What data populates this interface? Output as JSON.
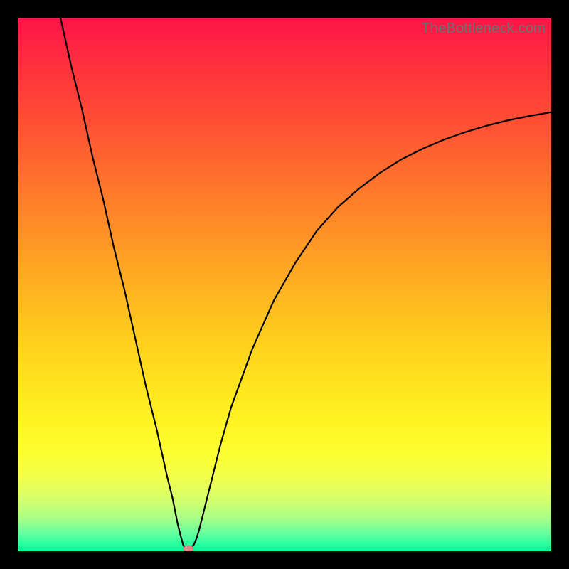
{
  "watermark": "TheBottleneck.com",
  "chart_data": {
    "type": "line",
    "title": "",
    "xlabel": "",
    "ylabel": "",
    "xlim": [
      0,
      100
    ],
    "ylim": [
      0,
      100
    ],
    "x": [
      8,
      10,
      12,
      14,
      16,
      18,
      20,
      22,
      24,
      26,
      28,
      29,
      30,
      30.5,
      31,
      31.5,
      32,
      32.5,
      33,
      33.5,
      34,
      35,
      36,
      38,
      40,
      44,
      48,
      52,
      56,
      60,
      64,
      68,
      72,
      76,
      80,
      84,
      88,
      92,
      96,
      100
    ],
    "y": [
      100,
      91,
      83,
      74,
      66,
      57,
      49,
      40,
      31,
      23,
      14,
      10,
      5,
      3,
      1.2,
      0.4,
      0.2,
      0.6,
      1.2,
      2.4,
      4,
      8,
      12,
      20,
      27,
      38,
      47,
      54,
      60,
      64.5,
      68,
      71,
      73.5,
      75.5,
      77.2,
      78.6,
      79.8,
      80.8,
      81.6,
      82.3
    ],
    "minimum_marker": {
      "x": 32,
      "y": 0.2
    },
    "gradient_stops": [
      {
        "pos": 0,
        "color": "#ff1447"
      },
      {
        "pos": 18,
        "color": "#ff4a36"
      },
      {
        "pos": 38,
        "color": "#ff8a28"
      },
      {
        "pos": 58,
        "color": "#ffc81e"
      },
      {
        "pos": 76,
        "color": "#fff423"
      },
      {
        "pos": 90,
        "color": "#d8ff6a"
      },
      {
        "pos": 100,
        "color": "#00ff9c"
      }
    ]
  }
}
